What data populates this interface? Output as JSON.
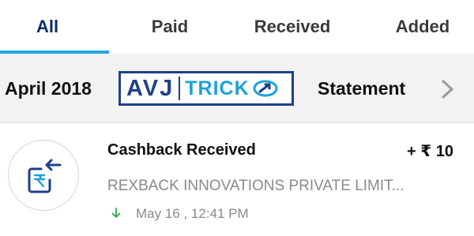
{
  "tabs": [
    {
      "label": "All",
      "active": true
    },
    {
      "label": "Paid",
      "active": false
    },
    {
      "label": "Received",
      "active": false
    },
    {
      "label": "Added",
      "active": false
    }
  ],
  "statement_bar": {
    "month": "April 2018",
    "logo": {
      "avj": "AVJ",
      "trick": "TRICK"
    },
    "statement_label": "Statement",
    "chevron_icon": "chevron-right-icon"
  },
  "transaction": {
    "icon": "rupee-incoming-icon",
    "title": "Cashback Received",
    "amount": "+ ₹ 10",
    "subtitle": "REXBACK INNOVATIONS PRIVATE LIMIT...",
    "time_icon": "arrow-down-icon",
    "time": "May 16 , 12:41 PM"
  },
  "colors": {
    "accent": "#1fa8e8",
    "active_tab": "#0c2d6b",
    "muted_text": "#8a8a8a",
    "credit_arrow": "#2ea84a",
    "logo_navy": "#1f3f8a",
    "logo_cyan": "#1ea2d8"
  }
}
